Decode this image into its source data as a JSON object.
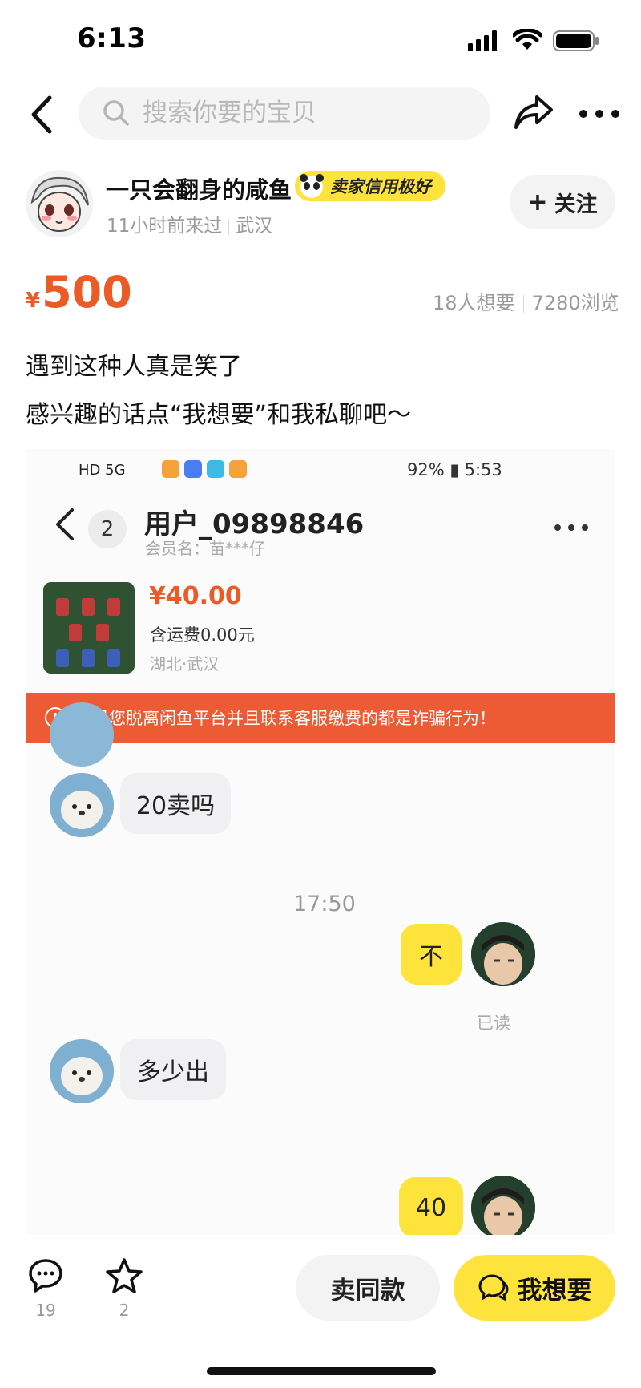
{
  "status_bar": {
    "time": "6:13"
  },
  "header": {
    "search_placeholder": "搜索你要的宝贝"
  },
  "seller": {
    "name": "一只会翻身的咸鱼",
    "credit_badge": "卖家信用极好",
    "last_seen": "11小时前来过",
    "location": "武汉",
    "follow_label": "关注"
  },
  "listing": {
    "currency": "¥",
    "price": "500",
    "wants": "18人想要",
    "views": "7280浏览",
    "desc_line1": "遇到这种人真是笑了",
    "desc_line2": "感兴趣的话点“我想要”和我私聊吧～"
  },
  "screenshot": {
    "status_left": "HD 5G",
    "status_right": "92% ▮ 5:53",
    "unread_count": "2",
    "user": "用户_09898846",
    "member_name": "会员名：苗***仔",
    "item_price": "¥40.00",
    "shipping": "含运费0.00元",
    "location": "湖北·武汉",
    "warning": "引导您脱离闲鱼平台并且联系客服缴费的都是诈骗行为！",
    "timestamp": "17:50",
    "read_label": "已读",
    "messages": [
      {
        "side": "left",
        "text": "20卖吗"
      },
      {
        "side": "right",
        "text": "不"
      },
      {
        "side": "left",
        "text": "多少出"
      },
      {
        "side": "right",
        "text": "40"
      }
    ]
  },
  "bottom_bar": {
    "comment_count": "19",
    "favorite_count": "2",
    "sell_same_label": "卖同款",
    "want_label": "我想要"
  },
  "colors": {
    "accent_yellow": "#ffe33d",
    "price_orange": "#ec5a26",
    "warning_red": "#ec5b33"
  }
}
